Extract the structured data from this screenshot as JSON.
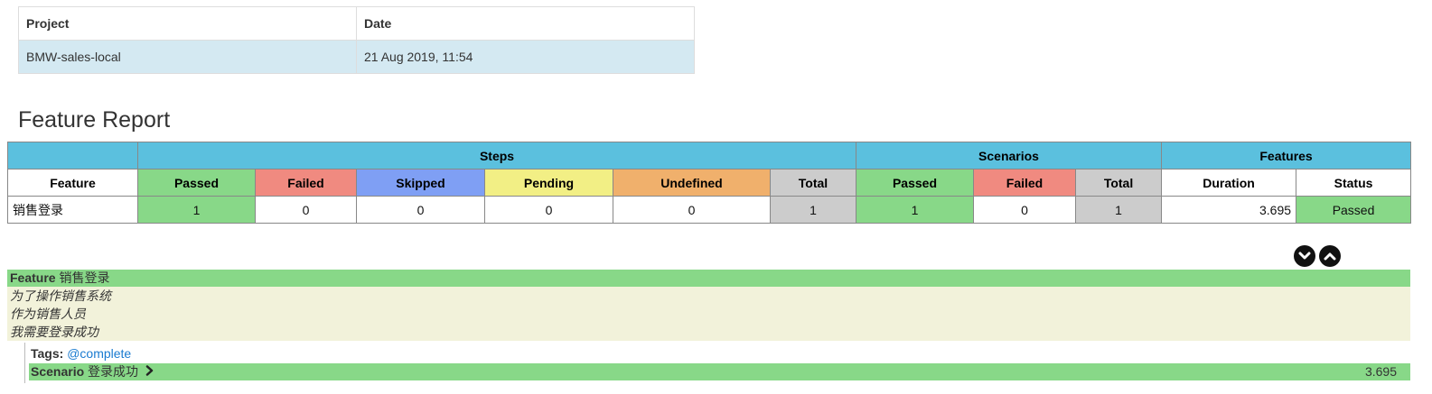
{
  "project_table": {
    "headers": [
      "Project",
      "Date"
    ],
    "row": [
      "BMW-sales-local",
      "21 Aug 2019, 11:54"
    ]
  },
  "title": "Feature Report",
  "report": {
    "group_headers": {
      "steps": "Steps",
      "scenarios": "Scenarios",
      "features": "Features"
    },
    "columns": {
      "feature": "Feature",
      "steps_passed": "Passed",
      "steps_failed": "Failed",
      "steps_skipped": "Skipped",
      "steps_pending": "Pending",
      "steps_undefined": "Undefined",
      "steps_total": "Total",
      "scen_passed": "Passed",
      "scen_failed": "Failed",
      "scen_total": "Total",
      "duration": "Duration",
      "status": "Status"
    },
    "row": {
      "feature": "销售登录",
      "steps_passed": "1",
      "steps_failed": "0",
      "steps_skipped": "0",
      "steps_pending": "0",
      "steps_undefined": "0",
      "steps_total": "1",
      "scen_passed": "1",
      "scen_failed": "0",
      "scen_total": "1",
      "duration": "3.695",
      "status": "Passed"
    }
  },
  "feature": {
    "keyword": "Feature",
    "name": "销售登录",
    "description": [
      "为了操作销售系统",
      "作为销售人员",
      "我需要登录成功"
    ],
    "tags_label": "Tags:",
    "tag": "@complete",
    "scenario_keyword": "Scenario",
    "scenario_name": "登录成功",
    "scenario_duration": "3.695"
  },
  "icons": {
    "expand": "chevron-down-icon",
    "collapse": "chevron-up-icon",
    "scenario_toggle": "chevron-right-icon"
  },
  "colors": {
    "passed": "#88d888",
    "failed": "#f08a80",
    "skipped": "#7f9ff4",
    "pending": "#f2ef85",
    "undefined": "#f0b06c",
    "total": "#cccccc",
    "info": "#5bc0de"
  }
}
